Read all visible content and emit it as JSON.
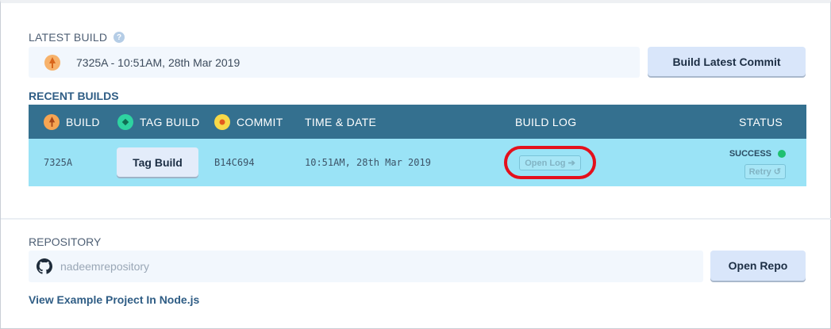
{
  "latest_build": {
    "label": "LATEST BUILD",
    "help_icon": "?",
    "summary": "7325A - 10:51AM, 28th Mar 2019",
    "build_button": "Build Latest Commit"
  },
  "recent_builds": {
    "label": "RECENT BUILDS",
    "columns": {
      "build": "BUILD",
      "tag_build": "TAG BUILD",
      "commit": "COMMIT",
      "time_date": "TIME & DATE",
      "build_log": "BUILD LOG",
      "status": "STATUS"
    },
    "rows": [
      {
        "build": "7325A",
        "tag_button": "Tag Build",
        "commit": "B14C694",
        "time_date": "10:51AM, 28th Mar 2019",
        "open_log": "Open Log ➔",
        "status": "SUCCESS",
        "retry": "Retry ↺"
      }
    ]
  },
  "repository": {
    "label": "REPOSITORY",
    "value": "nadeemrepository",
    "open_button": "Open Repo",
    "example_link": "View Example Project In Node.js"
  },
  "colors": {
    "header_bg": "#34708f",
    "row_bg": "#9ae3f6",
    "success": "#1fc070",
    "highlight": "#e4101c"
  }
}
